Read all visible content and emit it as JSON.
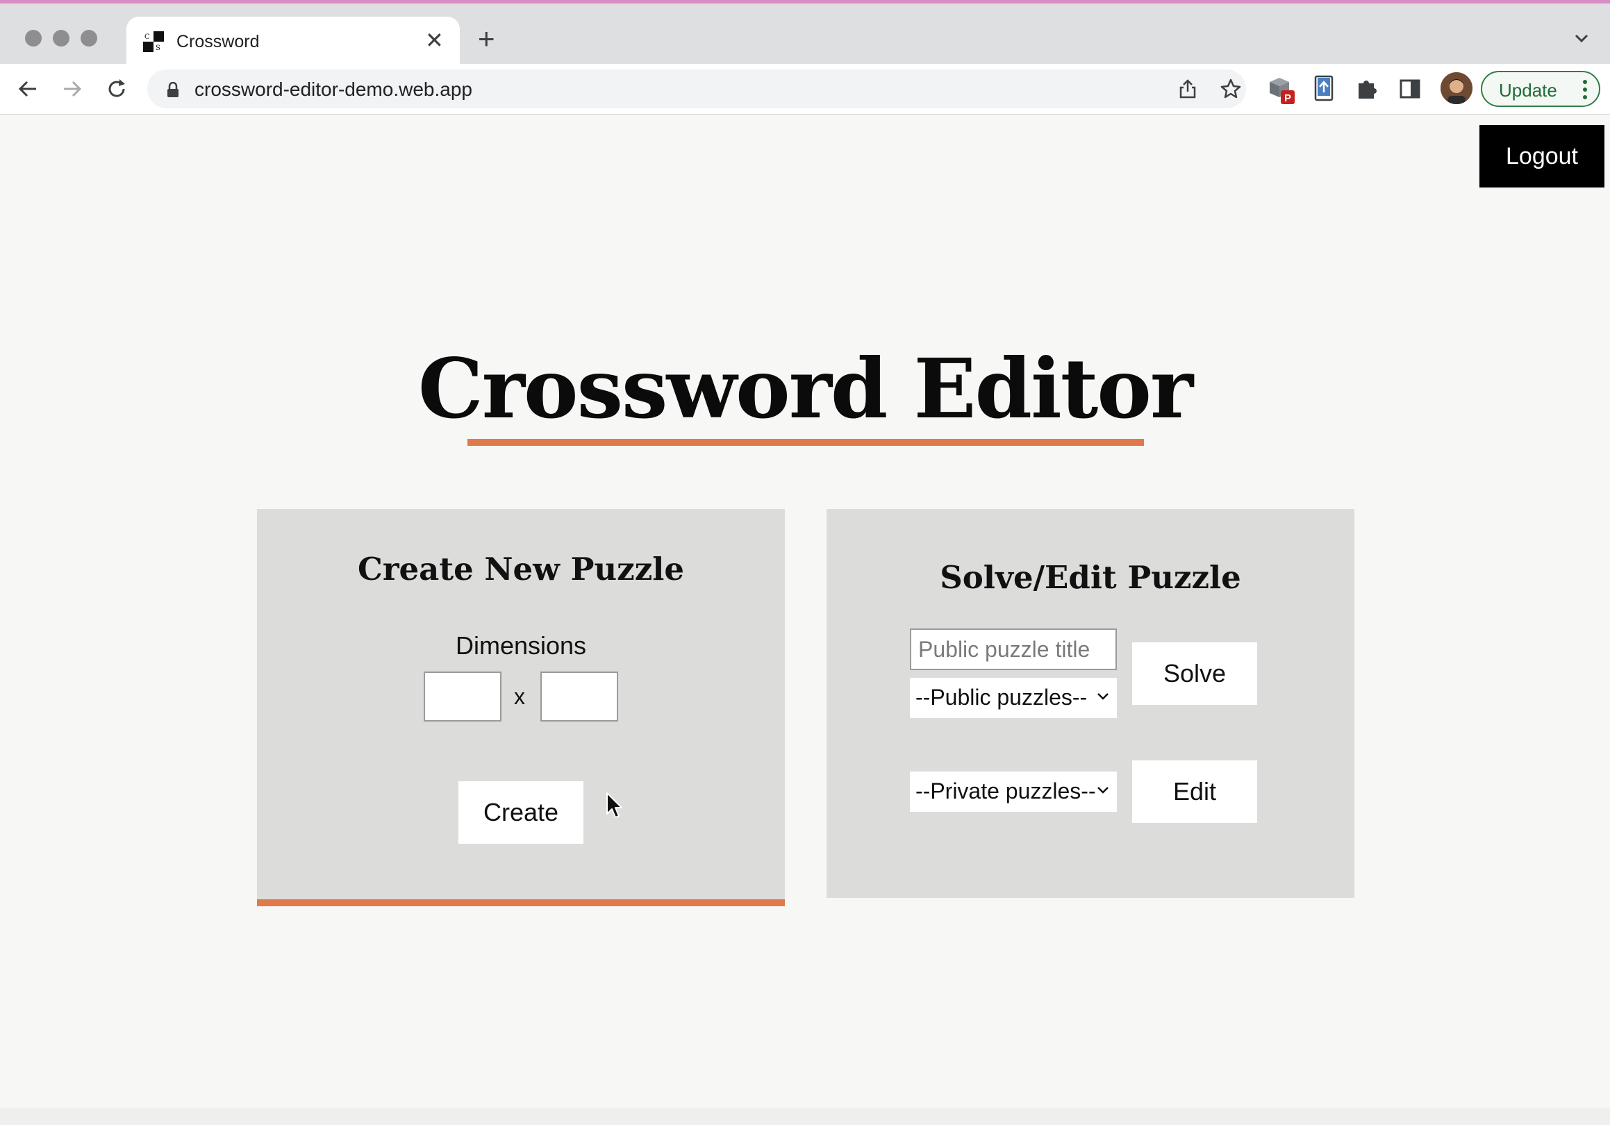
{
  "browser": {
    "tab_title": "Crossword",
    "url": "crossword-editor-demo.web.app",
    "update_label": "Update",
    "extension_badge": "P",
    "favicon_letters": [
      "C",
      "S"
    ]
  },
  "page": {
    "logout_label": "Logout",
    "title": "Crossword Editor",
    "accent_color": "#e07a4a"
  },
  "create": {
    "heading": "Create New Puzzle",
    "dimensions_label": "Dimensions",
    "width_value": "",
    "height_value": "",
    "separator": "x",
    "create_label": "Create"
  },
  "solve": {
    "heading": "Solve/Edit Puzzle",
    "title_placeholder": "Public puzzle title",
    "public_select": "--Public puzzles--",
    "solve_label": "Solve",
    "private_select": "--Private puzzles--",
    "edit_label": "Edit"
  }
}
